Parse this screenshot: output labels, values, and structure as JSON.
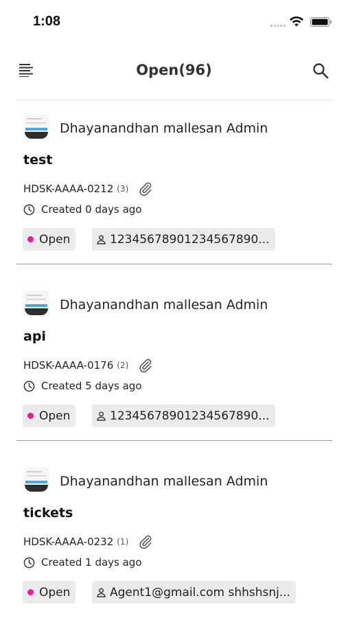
{
  "status_bar": {
    "time": "1:08"
  },
  "header": {
    "title": "Open(96)"
  },
  "tickets": [
    {
      "author": "Dhayanandhan mallesan Admin",
      "subject": "test",
      "ticket_id": "HDSK-AAAA-0212",
      "reply_count": "(3)",
      "created": "Created 0 days ago",
      "status": "Open",
      "status_color": "#e91e8c",
      "assignee": "12345678901234567890..."
    },
    {
      "author": "Dhayanandhan mallesan Admin",
      "subject": "api",
      "ticket_id": "HDSK-AAAA-0176",
      "reply_count": "(2)",
      "created": "Created 5 days ago",
      "status": "Open",
      "status_color": "#e91e8c",
      "assignee": "12345678901234567890..."
    },
    {
      "author": "Dhayanandhan mallesan Admin",
      "subject": "tickets",
      "ticket_id": "HDSK-AAAA-0232",
      "reply_count": "(1)",
      "created": "Created 1 days ago",
      "status": "Open",
      "status_color": "#e91e8c",
      "assignee": "Agent1@gmail.com shhshsnj..."
    }
  ],
  "icons": {
    "menu": "menu-icon",
    "search": "search-icon",
    "attachment": "paperclip-icon",
    "clock": "clock-icon",
    "assignee": "person-icon",
    "wifi": "wifi-icon",
    "battery": "battery-icon"
  }
}
